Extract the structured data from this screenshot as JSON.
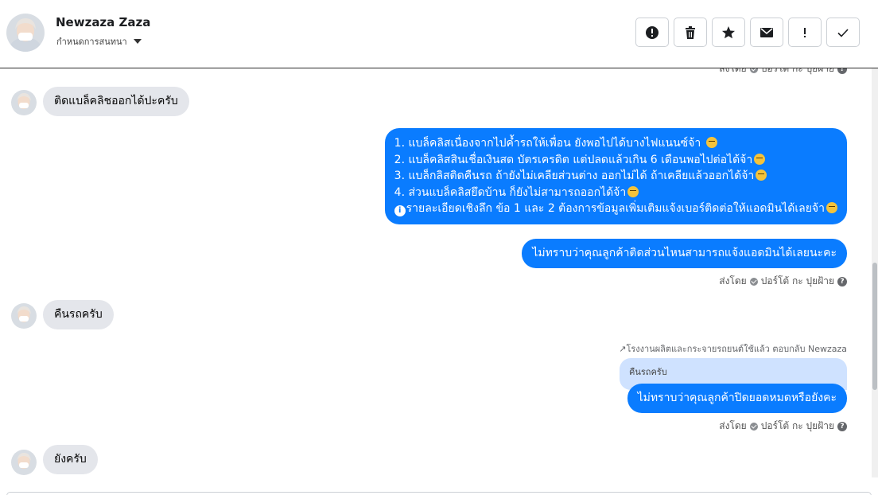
{
  "header": {
    "contact_name": "Newzaza Zaza",
    "assign_label": "กำหนดการสนทนา"
  },
  "toolbar": {
    "buttons": [
      "alert-circle-icon",
      "trash-icon",
      "star-icon",
      "mail-icon",
      "exclamation-icon",
      "check-icon"
    ]
  },
  "messages": {
    "m1": "ติดแบล็คลิชออกได้ปะครับ",
    "m2_lines": [
      "1. แบล็คลิสเนื่องจากไปค้ำรถให้เพื่อน ยังพอไปได้บางไฟแนนซ์จ้า",
      "2. แบล็คลิสสินเชื่อเงินสด บัตรเครดิต แต่ปลดแล้วเกิน 6 เดือนพอไปต่อได้จ้า",
      "3. แบล็กลิสติดคืนรถ ถ้ายังไม่เคลียส่วนต่าง ออกไม่ได้ ถ้าเคลียแล้วออกได้จ้า",
      "4. ส่วนแบล็คลิสยึดบ้าน ก็ยังไม่สามารถออกได้จ้า",
      "รายละเอียดเชิงลึก ข้อ 1 และ 2 ต้องการข้อมูลเพิ่มเติมแจ้งเบอร์ติดต่อให้แอดมินได้เลยจ้า"
    ],
    "m3": "ไม่ทราบว่าคุณลูกค้าติดส่วนไหนสามารถแจ้งแอดมินได้เลยนะคะ",
    "m4": "คืนรถครับ",
    "reply_note": "↗โรงงานผลิตและกระจายรถยนต์ใช้แล้ว ตอบกลับ Newzaza",
    "quoted_text": "คืนรถครับ",
    "m5": "ไม่ทราบว่าคุณลูกค้าปิดยอดหมดหรือยังคะ",
    "m6": "ยังครับ"
  },
  "sent_by": {
    "prefix": "ส่งโดย",
    "agent": "ปอร์โต้ กะ ปุยฝ้าย"
  }
}
